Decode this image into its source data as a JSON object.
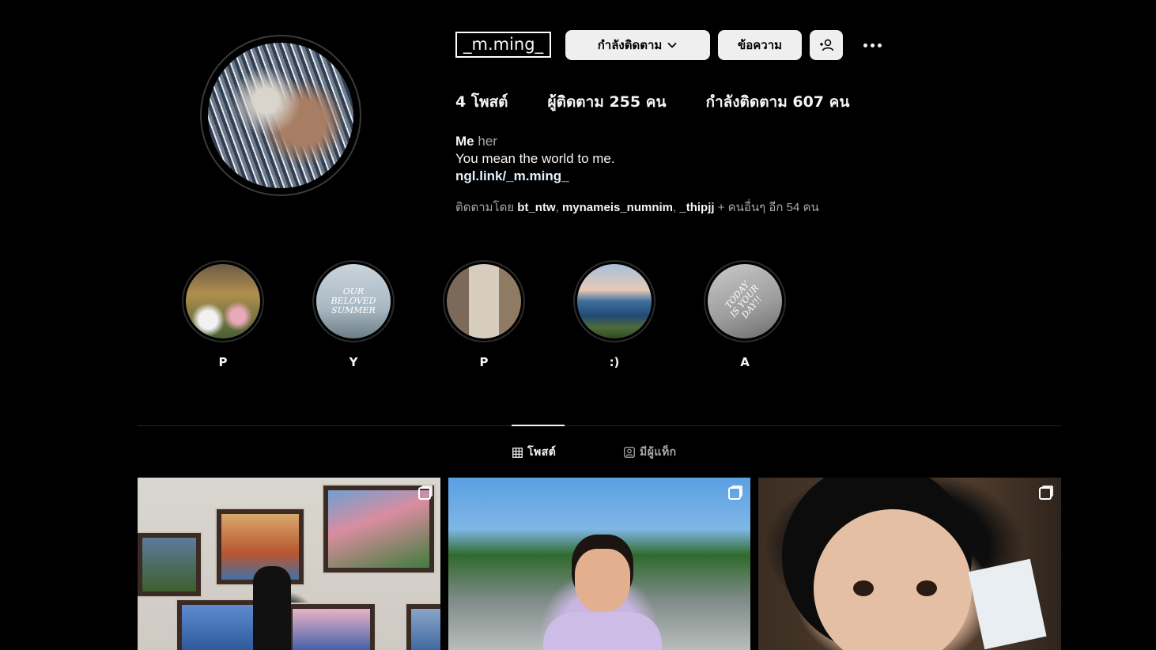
{
  "profile": {
    "username": "_m.ming_",
    "buttons": {
      "following": "กำลังติดตาม",
      "message": "ข้อความ"
    },
    "stats": {
      "posts": "4 โพสต์",
      "followers": "ผู้ติดตาม 255 คน",
      "following": "กำลังติดตาม 607 คน"
    },
    "bio": {
      "name": "Me",
      "pronoun": "her",
      "text": "You mean the world to me.",
      "link": "ngl.link/_m.ming_"
    },
    "followed_by": {
      "prefix": "ติดตามโดย",
      "users": [
        "bt_ntw",
        "mynameis_numnim",
        "_thipjj"
      ],
      "suffix": "+ คนอื่นๆ อีก 54 คน"
    }
  },
  "highlights": [
    {
      "label": "P",
      "overlay": ""
    },
    {
      "label": "Y",
      "overlay": "OUR BELOVED SUMMER"
    },
    {
      "label": "P",
      "overlay": ""
    },
    {
      "label": ":)",
      "overlay": ""
    },
    {
      "label": "A",
      "overlay": "TODAY IS YOUR DAY!!"
    }
  ],
  "tabs": {
    "posts": "โพสต์",
    "tagged": "มีผู้แท็ก"
  },
  "icons": {
    "chevron": "chevron-down-icon",
    "suggest": "add-person-icon",
    "more": "more-options-icon",
    "grid": "grid-icon",
    "tagged": "tagged-icon",
    "multi": "multiple-images-icon"
  },
  "colors": {
    "background": "#000000",
    "button_bg": "#efefef",
    "muted_text": "#a8a8a8"
  }
}
